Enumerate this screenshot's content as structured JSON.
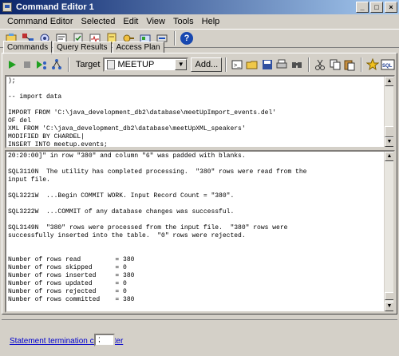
{
  "window": {
    "title": "Command Editor 1"
  },
  "menu": [
    "Command Editor",
    "Selected",
    "Edit",
    "View",
    "Tools",
    "Help"
  ],
  "tabs": [
    "Commands",
    "Query Results",
    "Access Plan"
  ],
  "toolbar": {
    "target_label": "Target",
    "target_value": "MEETUP",
    "add_label": "Add..."
  },
  "editor_text": ");\n\n-- import data\n\nIMPORT FROM 'C:\\java_development_db2\\database\\meetUpImport_events.del'\nOF del\nXML FROM 'C:\\java_development_db2\\database\\meetUpXML_speakers'\nMODIFIED BY CHARDEL|\nINSERT INTO meetup.events;",
  "output_text": "20:20:00]\" in row \"380\" and column \"6\" was padded with blanks.\n\nSQL3110N  The utility has completed processing.  \"380\" rows were read from the\ninput file.\n\nSQL3221W  ...Begin COMMIT WORK. Input Record Count = \"380\".\n\nSQL3222W  ...COMMIT of any database changes was successful.\n\nSQL3149N  \"380\" rows were processed from the input file.  \"380\" rows were\nsuccessfully inserted into the table.  \"0\" rows were rejected.\n\n\nNumber of rows read         = 380\nNumber of rows skipped      = 0\nNumber of rows inserted     = 380\nNumber of rows updated      = 0\nNumber of rows rejected     = 0\nNumber of rows committed    = 380",
  "footer": {
    "link_label": "Statement termination character",
    "term_char": ";"
  }
}
